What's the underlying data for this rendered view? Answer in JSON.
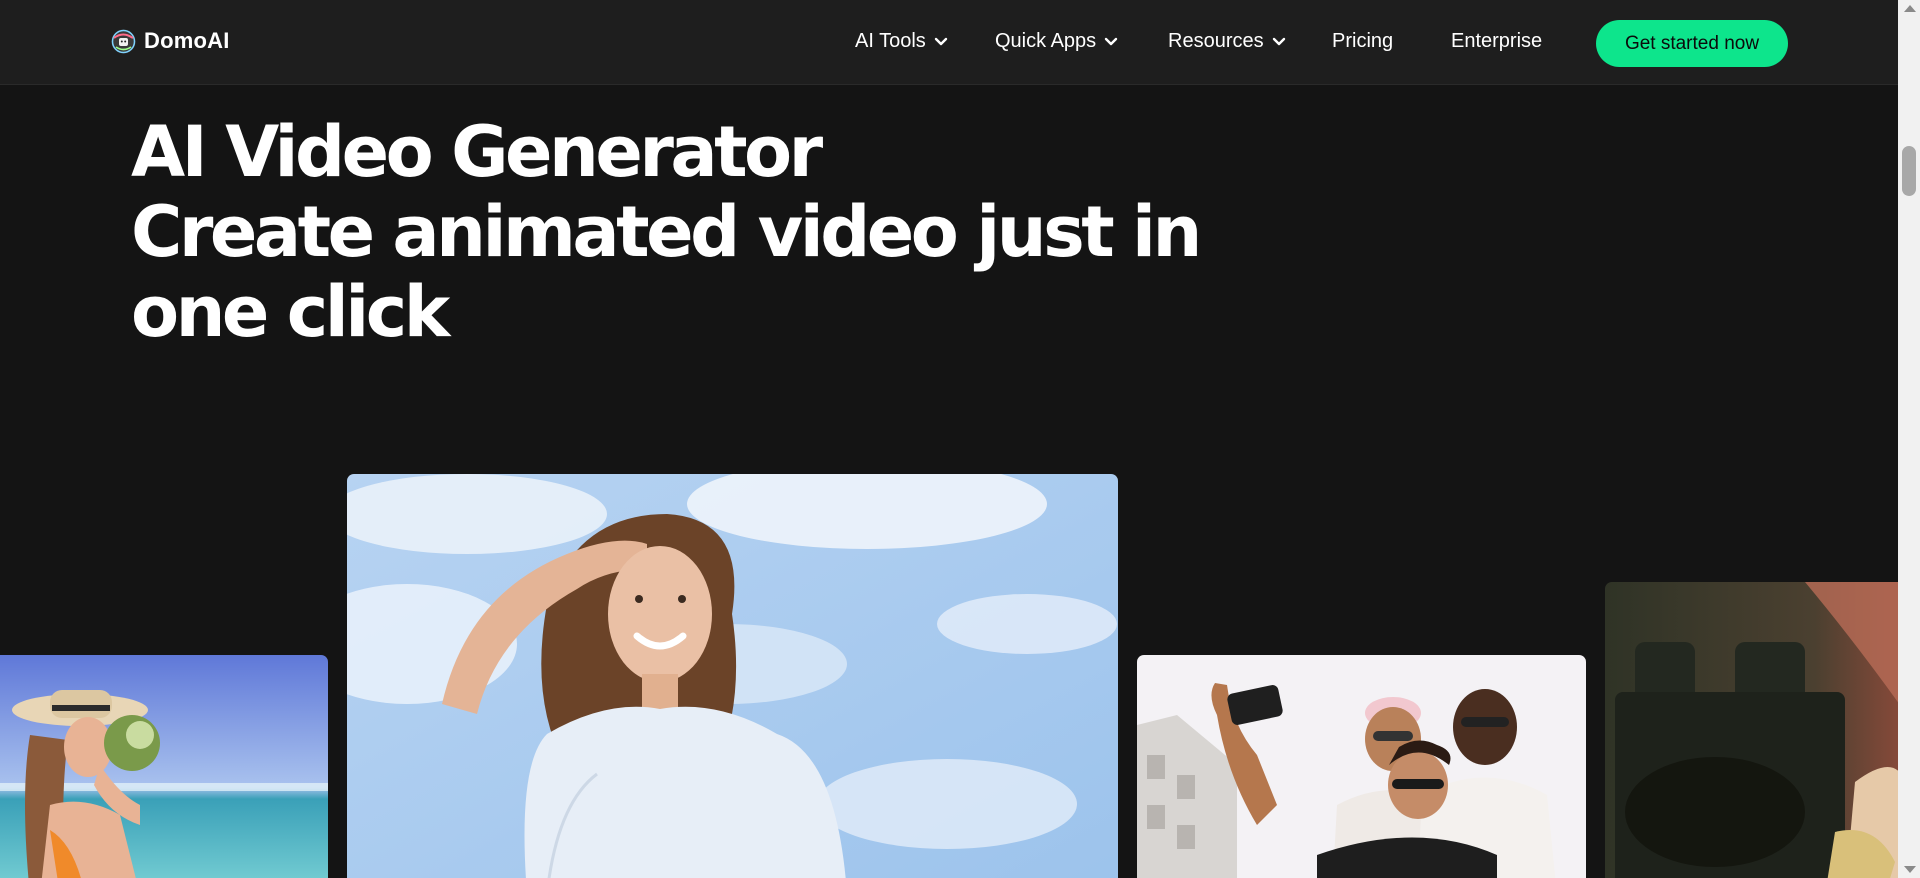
{
  "header": {
    "logo_text": "DomoAI",
    "nav": [
      {
        "label": "AI Tools",
        "has_dropdown": true
      },
      {
        "label": "Quick Apps",
        "has_dropdown": true
      },
      {
        "label": "Resources",
        "has_dropdown": true
      },
      {
        "label": "Pricing",
        "has_dropdown": false
      },
      {
        "label": "Enterprise",
        "has_dropdown": false
      }
    ],
    "cta_label": "Get started now"
  },
  "hero": {
    "line1": "AI Video Generator",
    "line2": "Create animated video just in",
    "line3": "one click"
  },
  "gallery": [
    {
      "name": "woman-drinking-coconut-beach"
    },
    {
      "name": "woman-smiling-sky"
    },
    {
      "name": "friends-selfie"
    },
    {
      "name": "car-interior"
    }
  ],
  "colors": {
    "background": "#141414",
    "header_background": "#1e1e1e",
    "accent": "#0de58c",
    "text": "#ffffff"
  }
}
